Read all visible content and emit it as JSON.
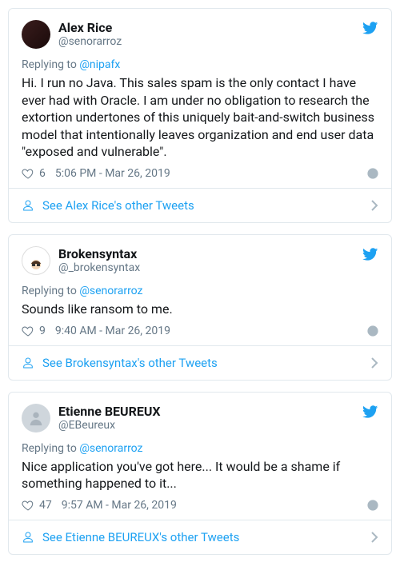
{
  "tweets": [
    {
      "display_name": "Alex Rice",
      "handle": "@senorarroz",
      "reply_prefix": "Replying to ",
      "reply_to": "@nipafx",
      "text": "Hi. I run no Java. This sales spam is the only contact I have ever had with Oracle. I am under no obligation to research the extortion undertones of this uniquely bait-and-switch business model that intentionally leaves organization and end user data \"exposed and vulnerable\".",
      "likes": "6",
      "timestamp": "5:06 PM - Mar 26, 2019",
      "see_more": "See Alex Rice's other Tweets"
    },
    {
      "display_name": "Brokensyntax",
      "handle": "@_brokensyntax",
      "reply_prefix": "Replying to ",
      "reply_to": "@senorarroz",
      "text": "Sounds like ransom to me.",
      "likes": "9",
      "timestamp": "9:40 AM - Mar 26, 2019",
      "see_more": "See Brokensyntax's other Tweets"
    },
    {
      "display_name": "Etienne BEUREUX",
      "handle": "@EBeureux",
      "reply_prefix": "Replying to ",
      "reply_to": "@senorarroz",
      "text": "Nice application you've got here... It would be a shame if something happened to it...",
      "likes": "47",
      "timestamp": "9:57 AM - Mar 26, 2019",
      "see_more": "See Etienne BEUREUX's other Tweets"
    }
  ]
}
